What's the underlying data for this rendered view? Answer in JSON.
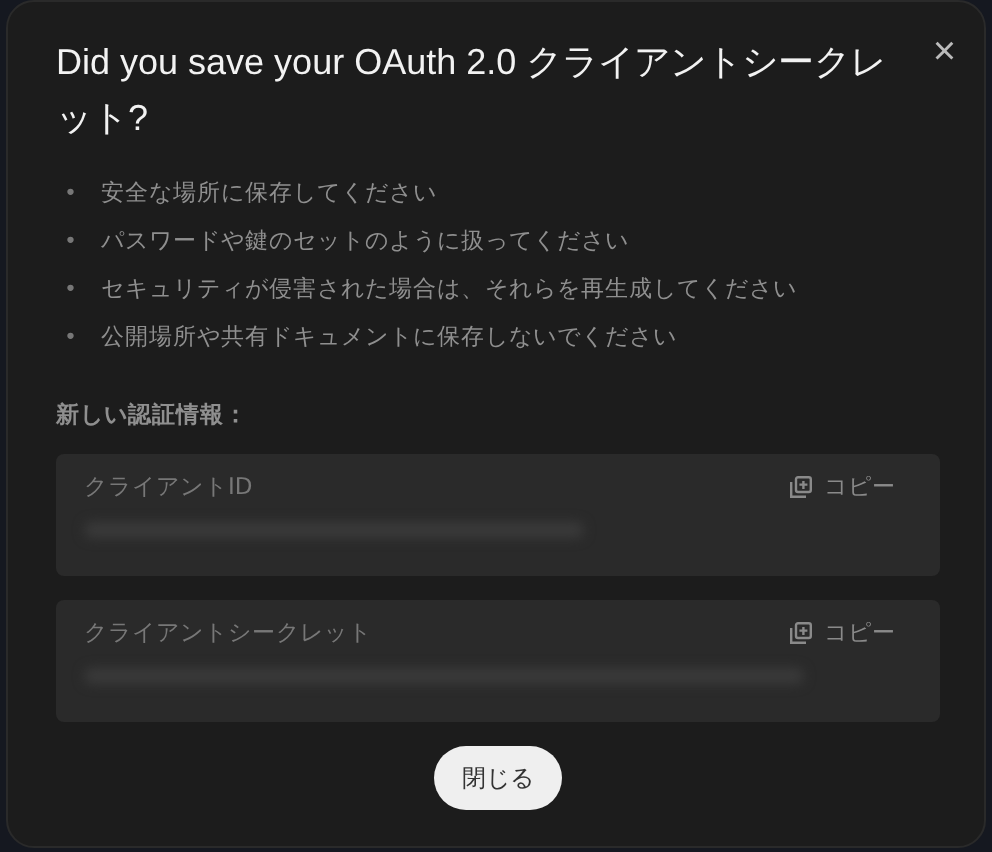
{
  "dialog": {
    "title": "Did you save your OAuth 2.0 クライアントシークレット?",
    "close": "×",
    "bullet_marker": "•",
    "bullets": [
      "安全な場所に保存してください",
      "パスワードや鍵のセットのように扱ってください",
      "セキュリティが侵害された場合は、それらを再生成してください",
      "公開場所や共有ドキュメントに保存しないでください"
    ],
    "section_label": "新しい認証情報：",
    "credentials": [
      {
        "label": "クライアントID",
        "copy": "コピー"
      },
      {
        "label": "クライアントシークレット",
        "copy": "コピー"
      }
    ],
    "button": "閉じる"
  }
}
